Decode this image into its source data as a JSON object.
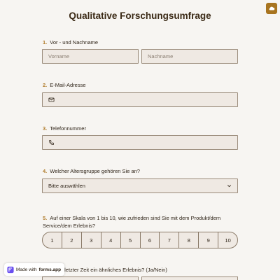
{
  "form": {
    "title": "Qualitative Forschungsumfrage"
  },
  "questions": [
    {
      "num": "1.",
      "label": "Vor - und Nachname"
    },
    {
      "num": "2.",
      "label": "E-Mail-Adresse"
    },
    {
      "num": "3.",
      "label": "Telefonnummer"
    },
    {
      "num": "4.",
      "label": "Welcher Altersgruppe gehören Sie an?"
    },
    {
      "num": "5.",
      "label": "Auf einer Skala von 1 bis 10, wie zufrieden sind Sie mit dem Produkt/dem Service/dem Erlebnis?"
    },
    {
      "num": "6.",
      "label": "Sie in letzter Zeit ein ähnliches Erlebnis? (Ja/Nein)"
    }
  ],
  "fields": {
    "first_name_placeholder": "Vorname",
    "last_name_placeholder": "Nachname",
    "select_value": "Bitte auswählen"
  },
  "scale": [
    "1",
    "2",
    "3",
    "4",
    "5",
    "6",
    "7",
    "8",
    "9",
    "10"
  ],
  "badge": {
    "made_with": "Made with",
    "brand": "forms.app"
  },
  "colors": {
    "accent": "#b07c2c",
    "field_bg": "#efe9e3",
    "field_border": "#9a8b7a",
    "page_bg": "#f7f5f2"
  },
  "icons": {
    "corner": "cloud-icon",
    "email": "mail-icon",
    "phone": "phone-icon",
    "select": "chevron-down-icon",
    "badge": "forms-app-logo-icon"
  }
}
